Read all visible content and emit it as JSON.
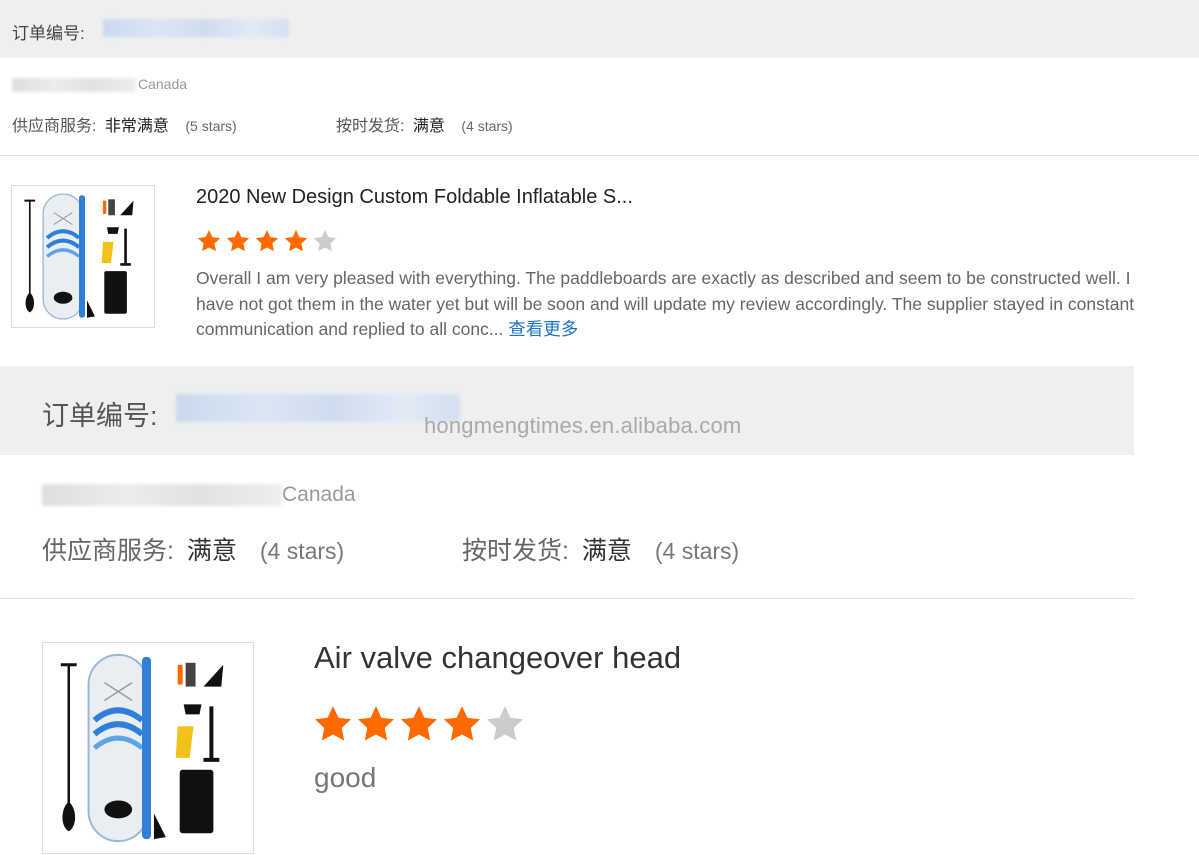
{
  "colors": {
    "star_filled": "#ff6a00",
    "star_empty": "#cccccc",
    "link": "#1a73c8",
    "header_bg": "#efefef"
  },
  "watermark": "hongmengtimes.en.alibaba.com",
  "reviews": [
    {
      "order_label": "订单编号:",
      "buyer_country": "Canada",
      "supplier_service_label": "供应商服务:",
      "supplier_service_value": "非常满意",
      "supplier_service_stars": "(5 stars)",
      "on_time_label": "按时发货:",
      "on_time_value": "满意",
      "on_time_stars": "(4 stars)",
      "product_title": "2020 New Design Custom Foldable Inflatable S...",
      "rating": 4,
      "rating_max": 5,
      "text": "Overall I am very pleased with everything. The paddleboards are exactly as described and seem to be constructed well. I have not got them in the water yet but will be soon and will update my review accordingly. The supplier stayed in constant communication and replied to all conc...",
      "more_link": "查看更多"
    },
    {
      "order_label": "订单编号:",
      "buyer_country": "Canada",
      "supplier_service_label": "供应商服务:",
      "supplier_service_value": "满意",
      "supplier_service_stars": "(4 stars)",
      "on_time_label": "按时发货:",
      "on_time_value": "满意",
      "on_time_stars": "(4 stars)",
      "product_title": "Air valve changeover head",
      "rating": 4,
      "rating_max": 5,
      "text": "good"
    }
  ]
}
